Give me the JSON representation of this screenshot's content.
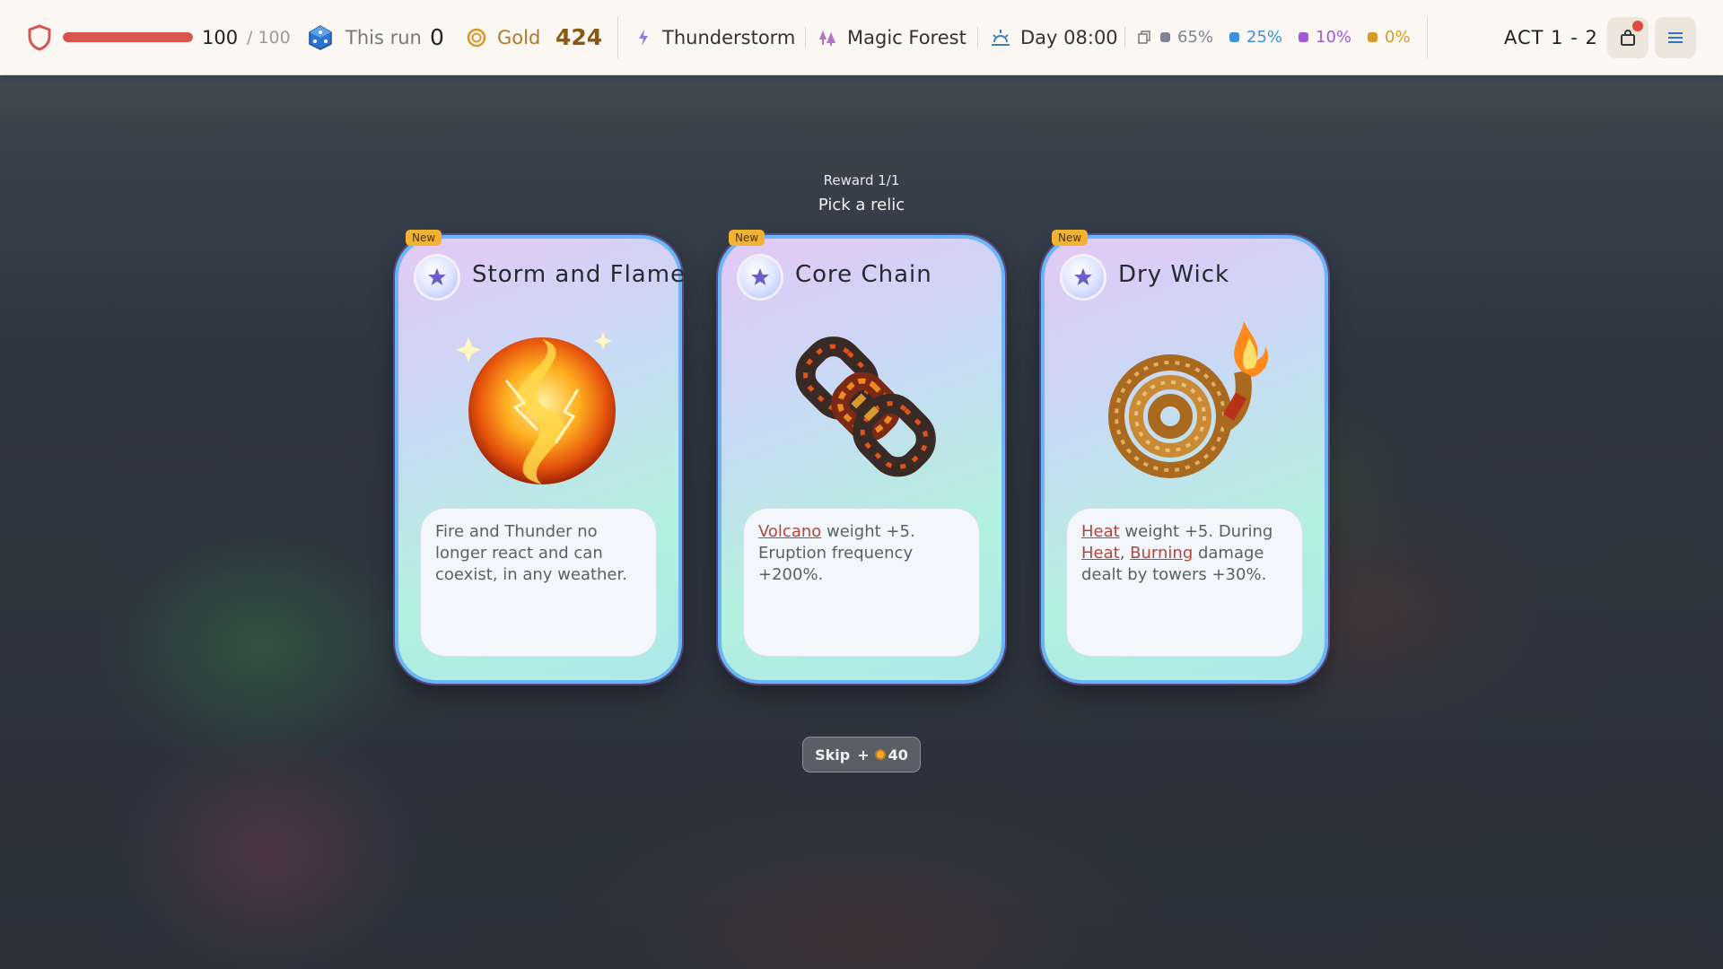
{
  "topbar": {
    "hp_current": "100",
    "hp_max": "/ 100",
    "hp_fraction": 1.0,
    "run_label": "This run",
    "run_value": "0",
    "gold_label": "Gold",
    "gold_value": "424",
    "weather": "Thunderstorm",
    "biome": "Magic Forest",
    "time": "Day 08:00",
    "rarity_odds": [
      {
        "value": "65%",
        "color": "#7d8593"
      },
      {
        "value": "25%",
        "color": "#3f8fe0"
      },
      {
        "value": "10%",
        "color": "#a05ad8"
      },
      {
        "value": "0%",
        "color": "#d59a2a"
      }
    ],
    "act": "ACT 1 - 2",
    "bag_icon": "bag-icon",
    "menu_icon": "menu-icon"
  },
  "reward": {
    "count": "Reward 1/1",
    "title": "Pick a relic"
  },
  "cards": [
    {
      "badge": "New",
      "title": "Storm and Flame",
      "icon": "star-icon",
      "art": "fire-thunder-orb",
      "desc_parts": [
        "Fire and Thunder no longer react and can coexist, in any weather."
      ]
    },
    {
      "badge": "New",
      "title": "Core Chain",
      "icon": "star-icon",
      "art": "lava-chain",
      "desc_kw1": "Volcano",
      "desc_parts": [
        " weight +5. Eruption frequency +200%."
      ]
    },
    {
      "badge": "New",
      "title": "Dry Wick",
      "icon": "star-icon",
      "art": "burning-rope",
      "desc_kw1": "Heat",
      "desc_text1": " weight +5. During ",
      "desc_kw2": "Heat",
      "desc_text2": ", ",
      "desc_kw3": "Burning",
      "desc_text3": " damage dealt by towers +30%."
    }
  ],
  "skip": {
    "label": "Skip",
    "plus": "+",
    "amount": "40"
  }
}
